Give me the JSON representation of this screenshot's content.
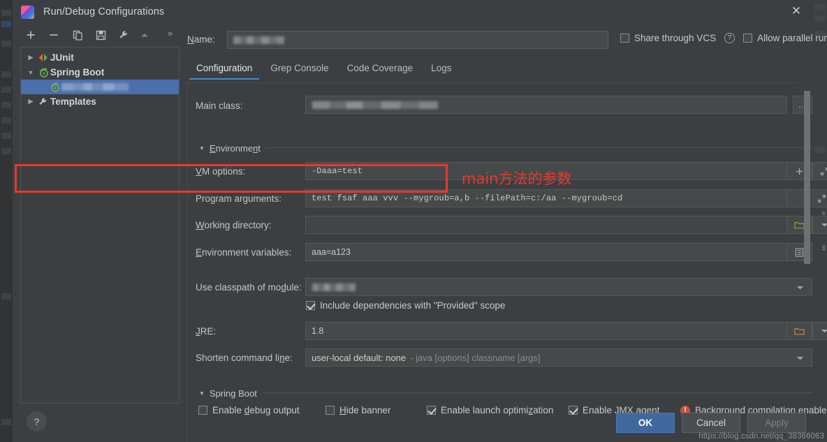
{
  "window": {
    "title": "Run/Debug Configurations",
    "close_label": "✕",
    "app_icon": "intellij-idea-icon"
  },
  "toolbar": {
    "add": "+",
    "remove": "−",
    "copy": "copy-icon",
    "save": "save-icon",
    "edit_templates": "wrench-icon",
    "move_up": "arrow-up-icon",
    "more": "»"
  },
  "tree": {
    "items": [
      {
        "label": "JUnit",
        "twisty": "▶",
        "icon": "junit-icon",
        "bold": true,
        "selected": false,
        "indent": 0
      },
      {
        "label": "Spring Boot",
        "twisty": "▼",
        "icon": "spring-boot-icon",
        "bold": true,
        "selected": false,
        "indent": 0
      },
      {
        "label": "",
        "twisty": "",
        "icon": "spring-boot-icon",
        "bold": false,
        "selected": true,
        "indent": 1,
        "redacted": true
      },
      {
        "label": "Templates",
        "twisty": "▶",
        "icon": "wrench-icon",
        "bold": true,
        "selected": false,
        "indent": 0
      }
    ]
  },
  "help": {
    "label": "?"
  },
  "name": {
    "label": "Name:",
    "label_mnemonic": "N",
    "value": "",
    "redacted": true
  },
  "options": {
    "share_through_vcs": {
      "label": "Share through VCS",
      "mnemonic": "S",
      "checked": false
    },
    "help_icon": "question-mark-icon",
    "allow_parallel_run": {
      "label": "Allow parallel run",
      "mnemonic": "n",
      "checked": false
    }
  },
  "tabs": [
    {
      "label": "Configuration",
      "active": true
    },
    {
      "label": "Grep Console",
      "active": false
    },
    {
      "label": "Code Coverage",
      "active": false
    },
    {
      "label": "Logs",
      "active": false
    }
  ],
  "fields": {
    "main_class": {
      "label": "Main class:",
      "value": "",
      "redacted": true,
      "browse_button": "…"
    },
    "environment_section": {
      "label": "Environment",
      "caret": "▼"
    },
    "vm_options": {
      "label": "VM options:",
      "mnemonic": "V",
      "value": "-Daaa=test",
      "add_button": "+",
      "expand_button": "expand-icon"
    },
    "program_arguments": {
      "label": "Program arguments:",
      "value": "test fsaf aaa vvv --mygroub=a,b --filePath=c:/aa --mygroub=cd",
      "expand_button": "expand-icon",
      "highlighted": true
    },
    "working_directory": {
      "label": "Working directory:",
      "mnemonic": "W",
      "value": "",
      "browse_button": "folder-icon",
      "dropdown_button": "chevron-down-icon"
    },
    "environment_variables": {
      "label": "Environment variables:",
      "mnemonic": "E",
      "value": "aaa=a123",
      "edit_button": "list-icon"
    },
    "use_classpath_of_module": {
      "label": "Use classpath of module:",
      "mnemonic": "d",
      "value": "",
      "redacted": true,
      "dropdown_button": "chevron-down-icon"
    },
    "include_provided_scope": {
      "label": "Include dependencies with \"Provided\" scope",
      "checked": true
    },
    "jre": {
      "label": "JRE:",
      "mnemonic": "J",
      "value": "1.8",
      "browse_button": "folder-icon",
      "dropdown_button": "chevron-down-icon"
    },
    "shorten_command_line": {
      "label": "Shorten command line:",
      "mnemonic": "n",
      "value": "user-local default: none",
      "value_hint": "- java [options] classname [args]",
      "dropdown_button": "chevron-down-icon"
    }
  },
  "spring_boot_section": {
    "label": "Spring Boot",
    "caret": "▼",
    "checkboxes": [
      {
        "label": "Enable debug output",
        "mnemonic": "d",
        "checked": false
      },
      {
        "label": "Hide banner",
        "mnemonic": "H",
        "checked": false
      },
      {
        "label": "Enable launch optimization",
        "mnemonic": "z",
        "checked": true
      },
      {
        "label": "Enable JMX agent",
        "mnemonic": "X",
        "checked": true
      }
    ],
    "warning": {
      "icon": "warning-icon",
      "text": "Background compilation enabled"
    }
  },
  "annotation": {
    "text": "main方法的参数",
    "color": "#e8392e"
  },
  "buttons": {
    "ok": "OK",
    "cancel": "Cancel",
    "apply": "Apply",
    "apply_disabled": true
  },
  "watermark": "https://blog.csdn.net/qq_38366063",
  "colors": {
    "dialog_bg": "#3c3f41",
    "field_bg": "#45494a",
    "accent_blue": "#4a88c7",
    "selection_blue": "#4b6eaf",
    "ok_button": "#41689c",
    "highlight_red": "#e8392e",
    "warning_red": "#cf4c46"
  }
}
